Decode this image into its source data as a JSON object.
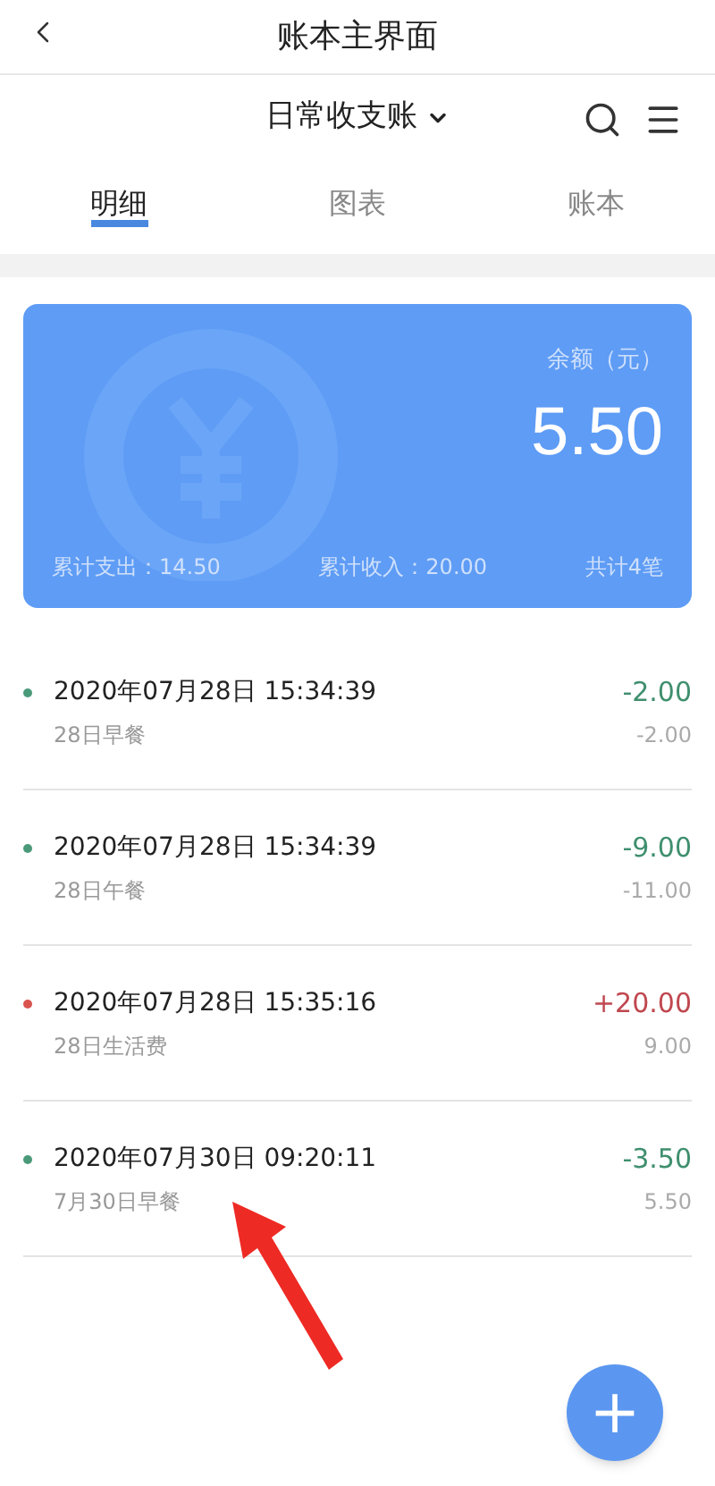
{
  "header": {
    "title": "账本主界面"
  },
  "book": {
    "name": "日常收支账"
  },
  "tabs": [
    {
      "label": "明细",
      "selected": true
    },
    {
      "label": "图表",
      "selected": false
    },
    {
      "label": "账本",
      "selected": false
    }
  ],
  "summary": {
    "balance_label": "余额（元）",
    "balance": "5.50",
    "expense": "累计支出：14.50",
    "income": "累计收入：20.00",
    "count": "共计4笔"
  },
  "entries": [
    {
      "kind": "expense",
      "time": "2020年07月28日 15:34:39",
      "note": "28日早餐",
      "amount": "-2.00",
      "balance": "-2.00"
    },
    {
      "kind": "expense",
      "time": "2020年07月28日 15:34:39",
      "note": "28日午餐",
      "amount": "-9.00",
      "balance": "-11.00"
    },
    {
      "kind": "income",
      "time": "2020年07月28日 15:35:16",
      "note": "28日生活费",
      "amount": "+20.00",
      "balance": "9.00"
    },
    {
      "kind": "expense",
      "time": "2020年07月30日 09:20:11",
      "note": "7月30日早餐",
      "amount": "-3.50",
      "balance": "5.50"
    }
  ],
  "fab": {
    "label": "+"
  }
}
